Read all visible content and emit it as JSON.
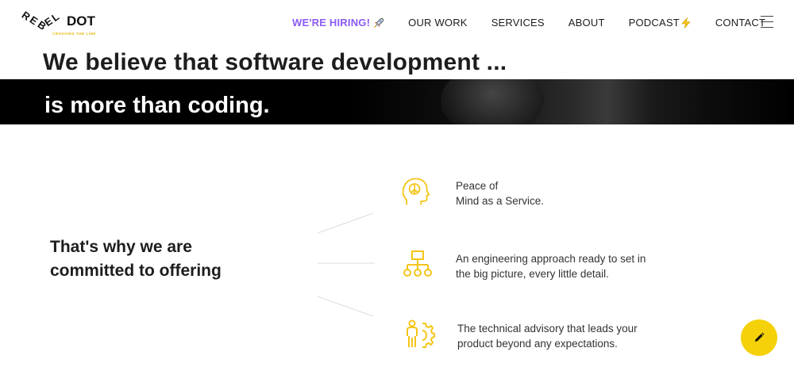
{
  "brand": {
    "logo_letters": "REBEL",
    "logo_word": "DOT",
    "tagline": "CROSSING THE LINE",
    "accent_color": "#f5d10a",
    "hiring_color": "#8b5cf6"
  },
  "nav": {
    "items": [
      {
        "label": "WE'RE HIRING!",
        "icon": "rocket-icon"
      },
      {
        "label": "OUR WORK"
      },
      {
        "label": "SERVICES"
      },
      {
        "label": "ABOUT"
      },
      {
        "label": "PODCAST",
        "icon": "lightning-icon"
      },
      {
        "label": "CONTACT"
      }
    ],
    "menu_icon": "hamburger-icon"
  },
  "hero": {
    "line1": "We believe that software development ...",
    "line2": "is more than coding."
  },
  "offering": {
    "heading_line1": "That's why we are",
    "heading_line2": "committed to offering",
    "features": [
      {
        "icon": "peace-head-icon",
        "line1": "Peace of",
        "line2": "Mind as a Service."
      },
      {
        "icon": "hierarchy-icon",
        "line1": "An engineering approach ready to set in",
        "line2": "the big picture, every little detail."
      },
      {
        "icon": "advisor-gear-icon",
        "line1": "The technical advisory that leads your",
        "line2": "product beyond any expectations."
      }
    ]
  },
  "fab": {
    "icon": "pencil-icon"
  }
}
